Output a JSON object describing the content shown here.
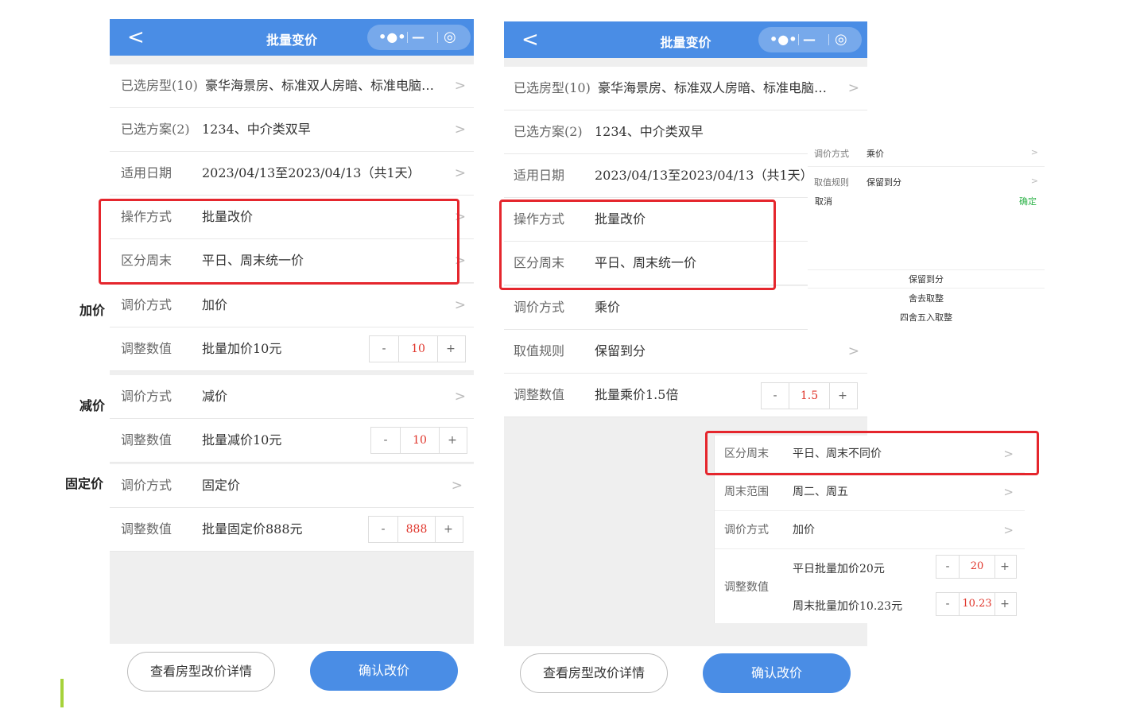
{
  "title": "批量变价",
  "icons": {
    "back": "<",
    "more": "•●•",
    "minimize": "—",
    "target": "◎",
    "chevron": ">"
  },
  "side_labels": {
    "add": "加价",
    "minus": "减价",
    "fixed": "固定价"
  },
  "left": {
    "rows": [
      {
        "label": "已选房型(10)",
        "value": "豪华海景房、标准双人房暗、标准电脑…"
      },
      {
        "label": "已选方案(2)",
        "value": "1234、中介类双早"
      },
      {
        "label": "适用日期",
        "value": "2023/04/13至2023/04/13（共1天）"
      },
      {
        "label": "操作方式",
        "value": "批量改价"
      },
      {
        "label": "区分周末",
        "value": "平日、周末统一价"
      },
      {
        "label": "调价方式",
        "value": "加价"
      },
      {
        "label": "调整数值",
        "value": "批量加价10元",
        "stepper": "10"
      },
      {
        "label": "调价方式",
        "value": "减价"
      },
      {
        "label": "调整数值",
        "value": "批量减价10元",
        "stepper": "10"
      },
      {
        "label": "调价方式",
        "value": "固定价"
      },
      {
        "label": "调整数值",
        "value": "批量固定价888元",
        "stepper": "888"
      }
    ],
    "stepper_minus": "-",
    "stepper_plus": "+",
    "detail_button": "查看房型改价详情",
    "confirm_button": "确认改价"
  },
  "right": {
    "rows": [
      {
        "label": "已选房型(10)",
        "value": "豪华海景房、标准双人房暗、标准电脑…"
      },
      {
        "label": "已选方案(2)",
        "value": "1234、中介类双早"
      },
      {
        "label": "适用日期",
        "value": "2023/04/13至2023/04/13（共1天）"
      },
      {
        "label": "操作方式",
        "value": "批量改价"
      },
      {
        "label": "区分周末",
        "value": "平日、周末统一价"
      },
      {
        "label": "调价方式",
        "value": "乘价"
      },
      {
        "label": "取值规则",
        "value": "保留到分"
      },
      {
        "label": "调整数值",
        "value": "批量乘价1.5倍",
        "stepper": "1.5"
      }
    ],
    "detail_button": "查看房型改价详情",
    "confirm_button": "确认改价"
  },
  "popup": {
    "rows": [
      {
        "label": "调价方式",
        "value": "乘价"
      },
      {
        "label": "取值规则",
        "value": "保留到分"
      }
    ],
    "cancel": "取消",
    "confirm": "确定",
    "options": [
      "保留到分",
      "舍去取整",
      "四舍五入取整"
    ]
  },
  "weekend_card": {
    "rows": [
      {
        "label": "区分周末",
        "value": "平日、周末不同价"
      },
      {
        "label": "周末范围",
        "value": "周二、周五"
      },
      {
        "label": "调价方式",
        "value": "加价"
      }
    ],
    "adjust_label": "调整数值",
    "weekday": {
      "value": "平日批量加价20元",
      "stepper": "20"
    },
    "weekend": {
      "value": "周末批量加价10.23元",
      "stepper": "10.23"
    }
  },
  "colors": {
    "accent": "#4a8de5",
    "highlight": "#e5262d",
    "confirm_text": "#2fb34a",
    "marker": "#a6d23a"
  }
}
